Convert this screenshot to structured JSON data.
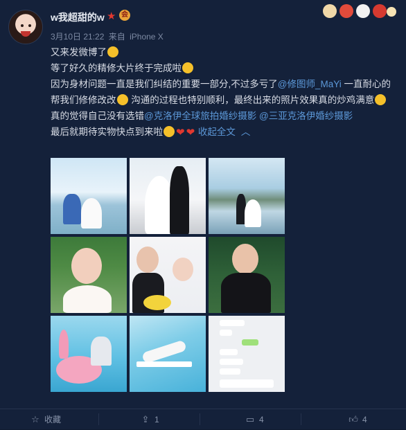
{
  "author": {
    "name": "w我超甜的w",
    "vip_star": "★",
    "badge": "会"
  },
  "meta": {
    "date": "3月10日 21:22",
    "from_prefix": "来自",
    "source": "iPhone X"
  },
  "content": {
    "line1": "又来发微博了",
    "line2": "等了好久的精修大片终于完成啦",
    "line3a": "因为身材问题一直是我们纠结的重要一部分,不过多亏了",
    "mention1": "@修图师_MaYi",
    "line3b": " 一直耐心的帮我们修修改改",
    "line3c": " 沟通的过程也特别顺利，最终出来的照片效果真的炒鸡满意",
    "line4a": "真的觉得自己没有选错",
    "mention2": "@克洛伊全球旅拍婚纱摄影",
    "mention3": "@三亚克洛伊婚纱摄影",
    "line5": "最后就期待实物快点到来啦",
    "collapse": "收起全文"
  },
  "photos": [
    {
      "scene": "seaside-couple"
    },
    {
      "scene": "bride-groom-sea"
    },
    {
      "scene": "glass-deck-couple"
    },
    {
      "scene": "bride-portrait"
    },
    {
      "scene": "couple-heart-hands"
    },
    {
      "scene": "groom-portrait"
    },
    {
      "scene": "flamingo-float"
    },
    {
      "scene": "pool-lounge"
    },
    {
      "scene": "chat-screenshot"
    }
  ],
  "actions": {
    "favorite": {
      "label": "收藏",
      "icon": "star-outline-icon"
    },
    "repost": {
      "count": "1",
      "icon": "repost-icon"
    },
    "comment": {
      "count": "4",
      "icon": "comment-icon"
    },
    "like": {
      "count": "4",
      "icon": "thumbs-up-icon"
    }
  },
  "colors": {
    "background": "#14213a",
    "link": "#5c98d8",
    "text": "#d9dde6",
    "meta": "#7d8aa3"
  }
}
